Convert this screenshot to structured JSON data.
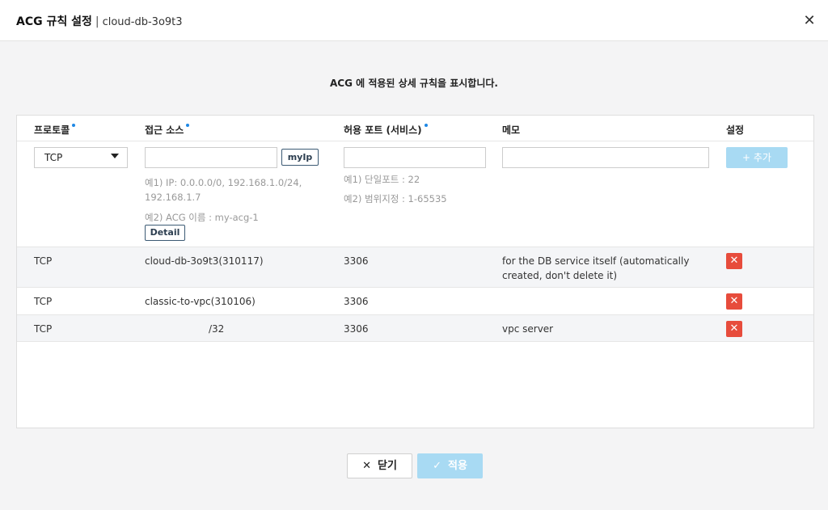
{
  "header": {
    "title": "ACG 규칙 설정",
    "separator": "|",
    "subtitle": "cloud-db-3o9t3",
    "close_icon": "✕"
  },
  "description": "ACG 에 적용된 상세 규칙을 표시합니다.",
  "columns": {
    "protocol": "프로토콜",
    "source": "접근 소스",
    "port": "허용 포트 (서비스)",
    "memo": "메모",
    "settings": "설정"
  },
  "form": {
    "protocol_value": "TCP",
    "source_value": "",
    "port_value": "",
    "memo_value": "",
    "myip_label": "myIp",
    "add_label": "+ 추가",
    "source_hint_1": "예1) IP: 0.0.0.0/0, 192.168.1.0/24, 192.168.1.7",
    "source_hint_2": "예2) ACG 이름 : my-acg-1",
    "detail_label": "Detail",
    "port_hint_1": "예1) 단일포트 : 22",
    "port_hint_2": "예2) 범위지정 : 1-65535"
  },
  "rules": [
    {
      "protocol": "TCP",
      "source": "cloud-db-3o9t3(310117)",
      "port": "3306",
      "memo": "for the DB service itself (automatically created, don't delete it)",
      "delete_icon": "✕"
    },
    {
      "protocol": "TCP",
      "source": "classic-to-vpc(310106)",
      "port": "3306",
      "memo": "",
      "delete_icon": "✕"
    },
    {
      "protocol": "TCP",
      "source": "/32",
      "port": "3306",
      "memo": "vpc server",
      "delete_icon": "✕"
    }
  ],
  "footer": {
    "close_label": "닫기",
    "close_icon": "✕",
    "apply_label": "적용",
    "apply_icon": "✓"
  },
  "colors": {
    "accent_dot": "#1e88e5",
    "delete_red": "#e74c3c",
    "disabled_blue": "#a8daf3"
  }
}
